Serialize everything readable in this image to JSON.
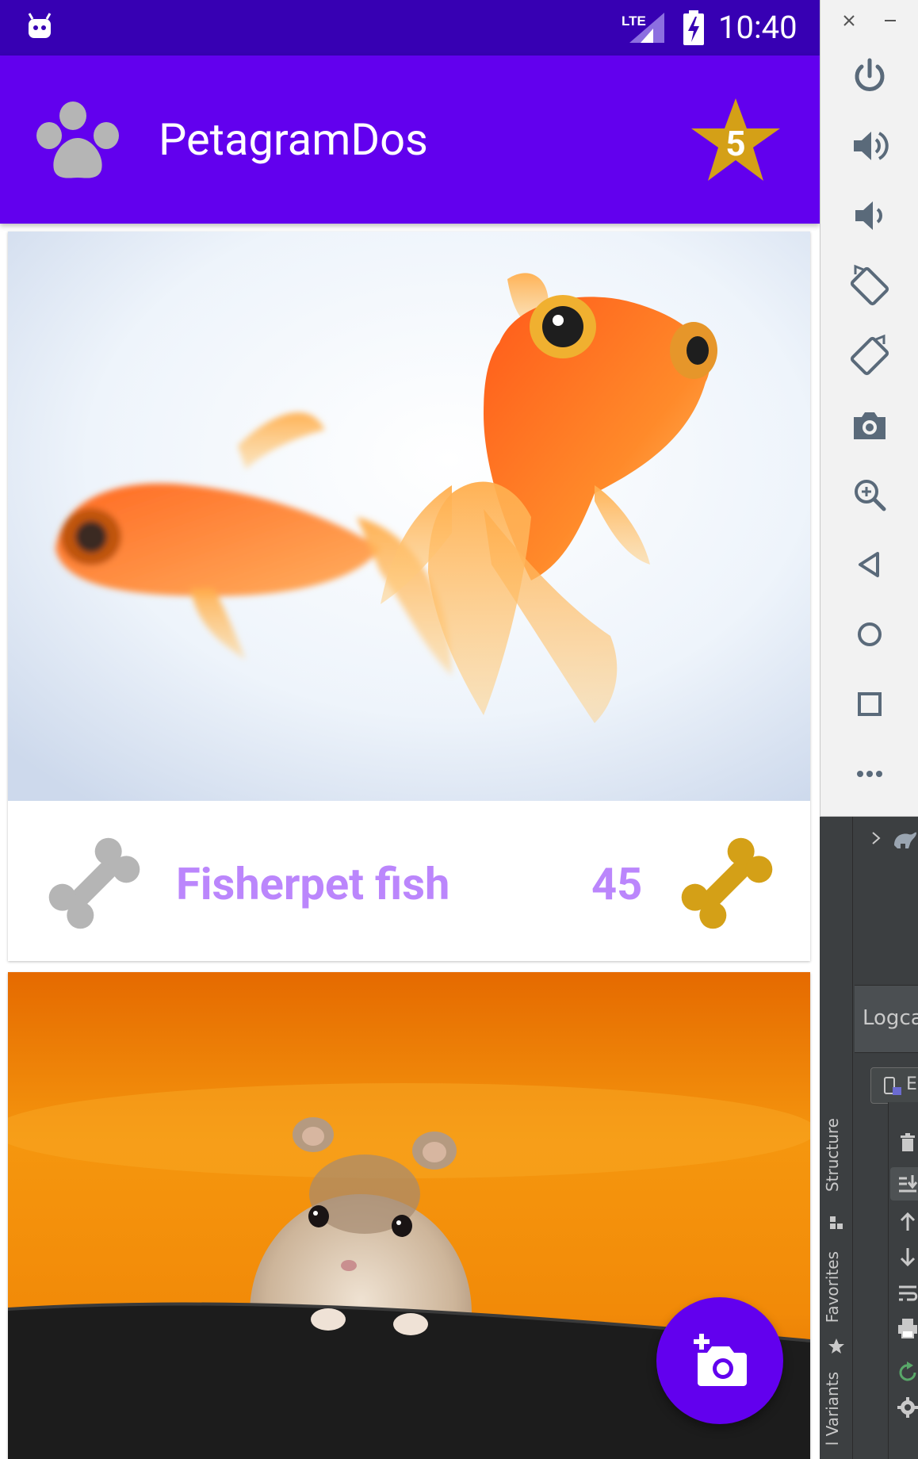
{
  "status_bar": {
    "time": "10:40",
    "network": "LTE",
    "background": "#3700b3"
  },
  "app_bar": {
    "title": "PetagramDos",
    "logo_icon": "paw-icon",
    "favorites_badge": {
      "icon": "star-icon",
      "count": "5",
      "color": "#d4a017"
    },
    "background": "#6200ee"
  },
  "feed": {
    "pets": [
      {
        "photo": "goldfish-photo",
        "name": "Fisherpet fish",
        "likes": "45",
        "like_button_icon": "bone-icon",
        "like_count_icon": "bone-icon"
      },
      {
        "photo": "hamster-photo"
      }
    ]
  },
  "fab": {
    "icon": "add-photo-camera-icon",
    "color": "#6200ee"
  },
  "emulator_toolbar": {
    "buttons": [
      "close",
      "minimize",
      "power",
      "volume-up",
      "volume-down",
      "rotate-left",
      "rotate-right",
      "screenshot",
      "zoom",
      "back",
      "home",
      "overview",
      "more"
    ]
  },
  "ide": {
    "logcat_tab_label": "Logca",
    "device_label": "E",
    "side_labels": {
      "structure": "Structure",
      "favorites": "Favorites",
      "build_variants": "l Variants"
    }
  },
  "colors": {
    "accent": "#bb86fc",
    "gold": "#d4a017",
    "grey_icon": "#b0b0b0"
  }
}
